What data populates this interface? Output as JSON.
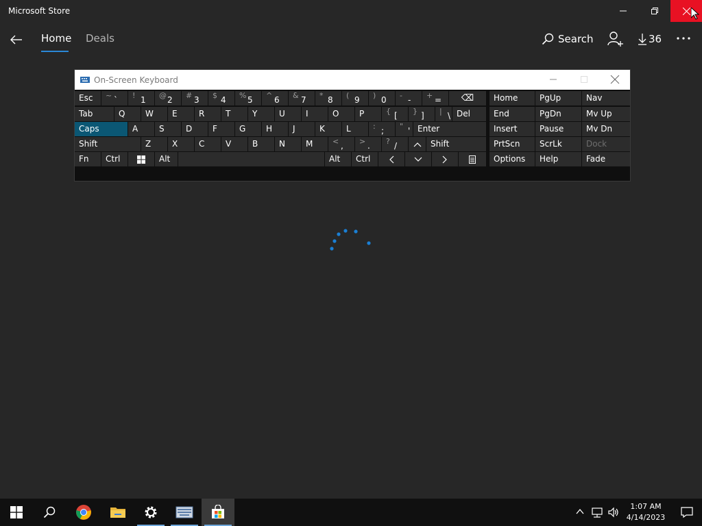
{
  "window": {
    "title": "Microsoft Store"
  },
  "nav": {
    "tabs": [
      {
        "label": "Home",
        "active": true
      },
      {
        "label": "Deals",
        "active": false
      }
    ],
    "search_label": "Search",
    "downloads_count": "36"
  },
  "osk": {
    "title": "On-Screen Keyboard",
    "rows": [
      [
        {
          "label": "Esc"
        },
        {
          "shift": "~",
          "main": "`"
        },
        {
          "shift": "!",
          "main": "1"
        },
        {
          "shift": "@",
          "main": "2"
        },
        {
          "shift": "#",
          "main": "3"
        },
        {
          "shift": "$",
          "main": "4"
        },
        {
          "shift": "%",
          "main": "5"
        },
        {
          "shift": "^",
          "main": "6"
        },
        {
          "shift": "&",
          "main": "7"
        },
        {
          "shift": "*",
          "main": "8"
        },
        {
          "shift": "(",
          "main": "9"
        },
        {
          "shift": ")",
          "main": "0"
        },
        {
          "shift": "-",
          "main": "-"
        },
        {
          "shift": "+",
          "main": "="
        },
        {
          "label": "⌫"
        }
      ],
      [
        {
          "label": "Tab"
        },
        {
          "label": "Q"
        },
        {
          "label": "W"
        },
        {
          "label": "E"
        },
        {
          "label": "R"
        },
        {
          "label": "T"
        },
        {
          "label": "Y"
        },
        {
          "label": "U"
        },
        {
          "label": "I"
        },
        {
          "label": "O"
        },
        {
          "label": "P"
        },
        {
          "shift": "{",
          "main": "["
        },
        {
          "shift": "}",
          "main": "]"
        },
        {
          "shift": "|",
          "main": "\\"
        },
        {
          "label": "Del"
        }
      ],
      [
        {
          "label": "Caps"
        },
        {
          "label": "A"
        },
        {
          "label": "S"
        },
        {
          "label": "D"
        },
        {
          "label": "F"
        },
        {
          "label": "G"
        },
        {
          "label": "H"
        },
        {
          "label": "J"
        },
        {
          "label": "K"
        },
        {
          "label": "L"
        },
        {
          "shift": ":",
          "main": ";"
        },
        {
          "shift": "\"",
          "main": "'"
        },
        {
          "label": "Enter"
        }
      ],
      [
        {
          "label": "Shift"
        },
        {
          "label": "Z"
        },
        {
          "label": "X"
        },
        {
          "label": "C"
        },
        {
          "label": "V"
        },
        {
          "label": "B"
        },
        {
          "label": "N"
        },
        {
          "label": "M"
        },
        {
          "shift": "<",
          "main": ","
        },
        {
          "shift": ">",
          "main": "."
        },
        {
          "shift": "?",
          "main": "/"
        },
        {
          "label": "up-arrow"
        },
        {
          "label": "Shift"
        }
      ],
      [
        {
          "label": "Fn"
        },
        {
          "label": "Ctrl"
        },
        {
          "label": "windows"
        },
        {
          "label": "Alt"
        },
        {
          "label": ""
        },
        {
          "label": "Alt"
        },
        {
          "label": "Ctrl"
        },
        {
          "label": "left-arrow"
        },
        {
          "label": "down-arrow"
        },
        {
          "label": "right-arrow"
        },
        {
          "label": "menu"
        }
      ]
    ],
    "nav_rows": [
      [
        "Home",
        "PgUp",
        "Nav"
      ],
      [
        "End",
        "PgDn",
        "Mv Up"
      ],
      [
        "Insert",
        "Pause",
        "Mv Dn"
      ],
      [
        "PrtScn",
        "ScrLk",
        "Dock"
      ],
      [
        "Options",
        "Help",
        "Fade"
      ]
    ]
  },
  "taskbar": {
    "time": "1:07 AM",
    "date": "4/14/2023"
  },
  "colors": {
    "accent": "#2b88d8",
    "close_red": "#e81123",
    "caps_highlight": "#0b5774"
  }
}
